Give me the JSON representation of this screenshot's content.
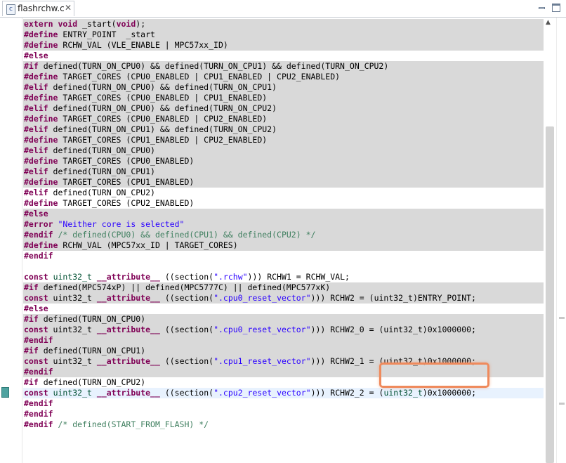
{
  "tab": {
    "title": "flashrchw.c",
    "close": "✕",
    "icon": "c"
  },
  "window": {
    "minimize": "minimize",
    "maximize": "maximize"
  },
  "colors": {
    "keyword": "#7f0055",
    "string": "#2a00ff",
    "comment": "#3f7f5f",
    "type_highlight": "#005032",
    "block_bg": "#d9d9d9",
    "current_line": "#e8f2fe",
    "callout": "#ef8a5c"
  },
  "lines": [
    {
      "hl": true,
      "tokens": [
        [
          "k",
          "extern"
        ],
        [
          "",
          "",
          ""
        ],
        [
          "k",
          " void"
        ],
        [
          "",
          " _start("
        ],
        [
          "k",
          "void"
        ],
        [
          "",
          ");"
        ]
      ]
    },
    {
      "hl": true,
      "tokens": [
        [
          "k",
          "#define"
        ],
        [
          "",
          " ENTRY_POINT  _start"
        ]
      ]
    },
    {
      "hl": true,
      "tokens": [
        [
          "k",
          "#define"
        ],
        [
          "",
          " RCHW_VAL (VLE_ENABLE | MPC57xx_ID)"
        ]
      ]
    },
    {
      "hl": false,
      "tokens": [
        [
          "k",
          "#else"
        ]
      ]
    },
    {
      "hl": true,
      "tokens": [
        [
          "k",
          "#if"
        ],
        [
          "",
          " defined(TURN_ON_CPU0) && defined(TURN_ON_CPU1) && defined(TURN_ON_CPU2)"
        ]
      ]
    },
    {
      "hl": true,
      "tokens": [
        [
          "k",
          "#define"
        ],
        [
          "",
          " TARGET_CORES (CPU0_ENABLED | CPU1_ENABLED | CPU2_ENABLED)"
        ]
      ]
    },
    {
      "hl": true,
      "tokens": [
        [
          "k",
          "#elif"
        ],
        [
          "",
          " defined(TURN_ON_CPU0) && defined(TURN_ON_CPU1)"
        ]
      ]
    },
    {
      "hl": true,
      "tokens": [
        [
          "k",
          "#define"
        ],
        [
          "",
          " TARGET_CORES (CPU0_ENABLED | CPU1_ENABLED)"
        ]
      ]
    },
    {
      "hl": true,
      "tokens": [
        [
          "k",
          "#elif"
        ],
        [
          "",
          " defined(TURN_ON_CPU0) && defined(TURN_ON_CPU2)"
        ]
      ]
    },
    {
      "hl": true,
      "tokens": [
        [
          "k",
          "#define"
        ],
        [
          "",
          " TARGET_CORES (CPU0_ENABLED | CPU2_ENABLED)"
        ]
      ]
    },
    {
      "hl": true,
      "tokens": [
        [
          "k",
          "#elif"
        ],
        [
          "",
          " defined(TURN_ON_CPU1) && defined(TURN_ON_CPU2)"
        ]
      ]
    },
    {
      "hl": true,
      "tokens": [
        [
          "k",
          "#define"
        ],
        [
          "",
          " TARGET_CORES (CPU1_ENABLED | CPU2_ENABLED)"
        ]
      ]
    },
    {
      "hl": true,
      "tokens": [
        [
          "k",
          "#elif"
        ],
        [
          "",
          " defined(TURN_ON_CPU0)"
        ]
      ]
    },
    {
      "hl": true,
      "tokens": [
        [
          "k",
          "#define"
        ],
        [
          "",
          " TARGET_CORES (CPU0_ENABLED)"
        ]
      ]
    },
    {
      "hl": true,
      "tokens": [
        [
          "k",
          "#elif"
        ],
        [
          "",
          " defined(TURN_ON_CPU1)"
        ]
      ]
    },
    {
      "hl": true,
      "tokens": [
        [
          "k",
          "#define"
        ],
        [
          "",
          " TARGET_CORES (CPU1_ENABLED)"
        ]
      ]
    },
    {
      "hl": false,
      "tokens": [
        [
          "k",
          "#elif"
        ],
        [
          "",
          " defined(TURN_ON_CPU2)"
        ]
      ]
    },
    {
      "hl": false,
      "tokens": [
        [
          "k",
          "#define"
        ],
        [
          "",
          " TARGET_CORES (CPU2_ENABLED)"
        ]
      ]
    },
    {
      "hl": true,
      "tokens": [
        [
          "k",
          "#else"
        ]
      ]
    },
    {
      "hl": true,
      "tokens": [
        [
          "k",
          "#error"
        ],
        [
          "s",
          " \"Neither core is selected\""
        ]
      ]
    },
    {
      "hl": true,
      "tokens": [
        [
          "k",
          "#endif"
        ],
        [
          "c",
          " /* defined(CPU0) && defined(CPU1) && defined(CPU2) */"
        ]
      ]
    },
    {
      "hl": true,
      "tokens": [
        [
          "k",
          "#define"
        ],
        [
          "",
          " RCHW_VAL (MPC57xx_ID | TARGET_CORES)"
        ]
      ]
    },
    {
      "hl": false,
      "tokens": [
        [
          "k",
          "#endif"
        ]
      ]
    },
    {
      "hl": false,
      "tokens": []
    },
    {
      "hl": false,
      "tokens": [
        [
          "k",
          "const"
        ],
        [
          "",
          " "
        ],
        [
          "h",
          "uint32_t"
        ],
        [
          "",
          " "
        ],
        [
          "k",
          "__attribute__"
        ],
        [
          "",
          " ((section("
        ],
        [
          "s",
          "\".rchw\""
        ],
        [
          "",
          ")))"
        ],
        [
          "",
          " RCHW1 = RCHW_VAL;"
        ]
      ]
    },
    {
      "hl": true,
      "tokens": [
        [
          "k",
          "#if"
        ],
        [
          "",
          " defined(MPC574xP) || defined(MPC5777C) || defined(MPC577xK)"
        ]
      ]
    },
    {
      "hl": true,
      "tokens": [
        [
          "k",
          "const"
        ],
        [
          "",
          " uint32_t "
        ],
        [
          "k",
          "__attribute__"
        ],
        [
          "",
          " ((section("
        ],
        [
          "s",
          "\".cpu0_reset_vector\""
        ],
        [
          "",
          ")))"
        ],
        [
          "",
          " RCHW2 = (uint32_t)ENTRY_POINT;"
        ]
      ]
    },
    {
      "hl": false,
      "tokens": [
        [
          "k",
          "#else"
        ]
      ]
    },
    {
      "hl": true,
      "tokens": [
        [
          "k",
          "#if"
        ],
        [
          "",
          " defined(TURN_ON_CPU0)"
        ]
      ]
    },
    {
      "hl": true,
      "tokens": [
        [
          "k",
          "const"
        ],
        [
          "",
          " uint32_t "
        ],
        [
          "k",
          "__attribute__"
        ],
        [
          "",
          " ((section("
        ],
        [
          "s",
          "\".cpu0_reset_vector\""
        ],
        [
          "",
          ")))"
        ],
        [
          "",
          " RCHW2_0 = (uint32_t)0x1000000;"
        ]
      ]
    },
    {
      "hl": true,
      "tokens": [
        [
          "k",
          "#endif"
        ]
      ]
    },
    {
      "hl": true,
      "tokens": [
        [
          "k",
          "#if"
        ],
        [
          "",
          " defined(TURN_ON_CPU1)"
        ]
      ]
    },
    {
      "hl": true,
      "tokens": [
        [
          "k",
          "const"
        ],
        [
          "",
          " uint32_t "
        ],
        [
          "k",
          "__attribute__"
        ],
        [
          "",
          " ((section("
        ],
        [
          "s",
          "\".cpu1_reset_vector\""
        ],
        [
          "",
          ")))"
        ],
        [
          "",
          " RCHW2_1 = (uint32_t)0x1000000;"
        ]
      ]
    },
    {
      "hl": true,
      "tokens": [
        [
          "k",
          "#endif"
        ]
      ]
    },
    {
      "hl": false,
      "tokens": [
        [
          "k",
          "#if"
        ],
        [
          "",
          " defined(TURN_ON_CPU2)"
        ]
      ]
    },
    {
      "hl": false,
      "cur": true,
      "tokens": [
        [
          "k",
          "const"
        ],
        [
          "",
          " "
        ],
        [
          "h",
          "uint32_t"
        ],
        [
          "",
          " "
        ],
        [
          "k",
          "__attribute__"
        ],
        [
          "",
          " ((section("
        ],
        [
          "s",
          "\".cpu2_reset_vector\""
        ],
        [
          "",
          ")))"
        ],
        [
          "",
          " RCHW2_2 = ("
        ],
        [
          "h",
          "uint32_t"
        ],
        [
          "",
          ")0x1000000;"
        ]
      ]
    },
    {
      "hl": false,
      "tokens": [
        [
          "k",
          "#endif"
        ]
      ]
    },
    {
      "hl": false,
      "tokens": [
        [
          "k",
          "#endif"
        ]
      ]
    },
    {
      "hl": false,
      "tokens": [
        [
          "k",
          "#endif"
        ],
        [
          "c",
          " /* defined(START_FROM_FLASH) */"
        ]
      ]
    }
  ]
}
